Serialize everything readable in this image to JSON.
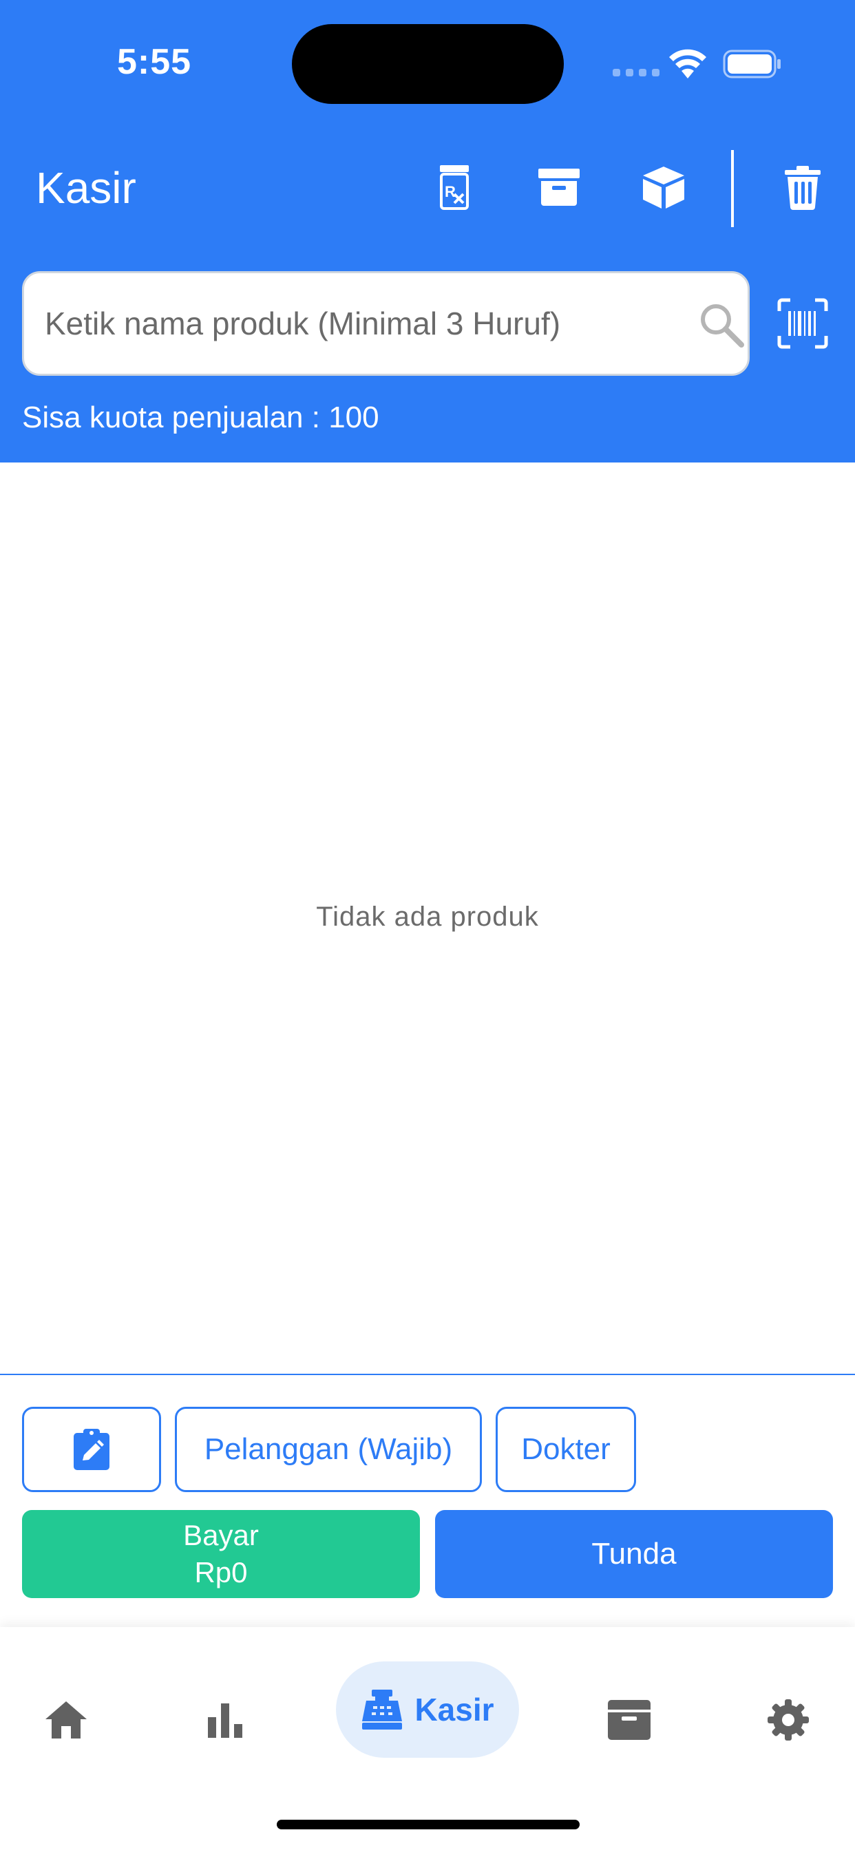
{
  "status_bar": {
    "time": "5:55",
    "icons": [
      "signal-icon",
      "wifi-icon",
      "battery-icon"
    ]
  },
  "header": {
    "title": "Kasir",
    "actions": [
      "prescription-icon",
      "archive-icon",
      "box-icon",
      "trash-icon"
    ],
    "background_color": "#2D7CF6"
  },
  "search": {
    "placeholder": "Ketik nama produk (Minimal 3 Huruf)",
    "value": "",
    "scan_icon": "barcode-scan-icon"
  },
  "quota": {
    "text": "Sisa kuota penjualan : 100"
  },
  "cart": {
    "empty_text": "Tidak ada produk"
  },
  "action_row": {
    "note_icon": "clipboard-edit-icon",
    "customer_label": "Pelanggan (Wajib)",
    "doctor_label": "Dokter"
  },
  "checkout": {
    "pay_label": "Bayar",
    "pay_amount": "Rp0",
    "hold_label": "Tunda",
    "pay_color": "#22C993",
    "hold_color": "#2D7CF6"
  },
  "bottom_nav": {
    "items": [
      {
        "icon": "home-icon",
        "label": ""
      },
      {
        "icon": "bar-chart-icon",
        "label": ""
      },
      {
        "icon": "cash-register-icon",
        "label": "Kasir",
        "active": true
      },
      {
        "icon": "archive-icon",
        "label": ""
      },
      {
        "icon": "settings-icon",
        "label": ""
      }
    ]
  }
}
